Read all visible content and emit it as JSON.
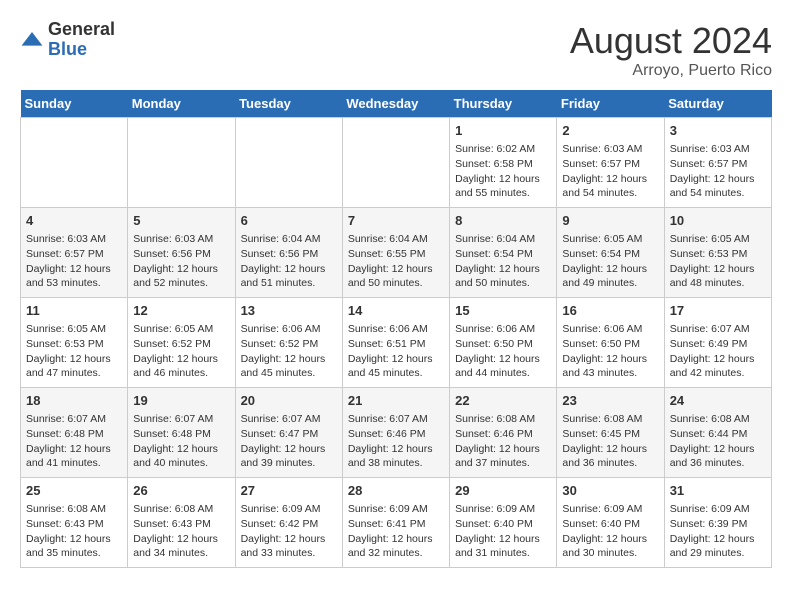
{
  "header": {
    "logo_general": "General",
    "logo_blue": "Blue",
    "main_title": "August 2024",
    "subtitle": "Arroyo, Puerto Rico"
  },
  "calendar": {
    "days_of_week": [
      "Sunday",
      "Monday",
      "Tuesday",
      "Wednesday",
      "Thursday",
      "Friday",
      "Saturday"
    ],
    "weeks": [
      [
        {
          "day": "",
          "info": ""
        },
        {
          "day": "",
          "info": ""
        },
        {
          "day": "",
          "info": ""
        },
        {
          "day": "",
          "info": ""
        },
        {
          "day": "1",
          "info": "Sunrise: 6:02 AM\nSunset: 6:58 PM\nDaylight: 12 hours\nand 55 minutes."
        },
        {
          "day": "2",
          "info": "Sunrise: 6:03 AM\nSunset: 6:57 PM\nDaylight: 12 hours\nand 54 minutes."
        },
        {
          "day": "3",
          "info": "Sunrise: 6:03 AM\nSunset: 6:57 PM\nDaylight: 12 hours\nand 54 minutes."
        }
      ],
      [
        {
          "day": "4",
          "info": "Sunrise: 6:03 AM\nSunset: 6:57 PM\nDaylight: 12 hours\nand 53 minutes."
        },
        {
          "day": "5",
          "info": "Sunrise: 6:03 AM\nSunset: 6:56 PM\nDaylight: 12 hours\nand 52 minutes."
        },
        {
          "day": "6",
          "info": "Sunrise: 6:04 AM\nSunset: 6:56 PM\nDaylight: 12 hours\nand 51 minutes."
        },
        {
          "day": "7",
          "info": "Sunrise: 6:04 AM\nSunset: 6:55 PM\nDaylight: 12 hours\nand 50 minutes."
        },
        {
          "day": "8",
          "info": "Sunrise: 6:04 AM\nSunset: 6:54 PM\nDaylight: 12 hours\nand 50 minutes."
        },
        {
          "day": "9",
          "info": "Sunrise: 6:05 AM\nSunset: 6:54 PM\nDaylight: 12 hours\nand 49 minutes."
        },
        {
          "day": "10",
          "info": "Sunrise: 6:05 AM\nSunset: 6:53 PM\nDaylight: 12 hours\nand 48 minutes."
        }
      ],
      [
        {
          "day": "11",
          "info": "Sunrise: 6:05 AM\nSunset: 6:53 PM\nDaylight: 12 hours\nand 47 minutes."
        },
        {
          "day": "12",
          "info": "Sunrise: 6:05 AM\nSunset: 6:52 PM\nDaylight: 12 hours\nand 46 minutes."
        },
        {
          "day": "13",
          "info": "Sunrise: 6:06 AM\nSunset: 6:52 PM\nDaylight: 12 hours\nand 45 minutes."
        },
        {
          "day": "14",
          "info": "Sunrise: 6:06 AM\nSunset: 6:51 PM\nDaylight: 12 hours\nand 45 minutes."
        },
        {
          "day": "15",
          "info": "Sunrise: 6:06 AM\nSunset: 6:50 PM\nDaylight: 12 hours\nand 44 minutes."
        },
        {
          "day": "16",
          "info": "Sunrise: 6:06 AM\nSunset: 6:50 PM\nDaylight: 12 hours\nand 43 minutes."
        },
        {
          "day": "17",
          "info": "Sunrise: 6:07 AM\nSunset: 6:49 PM\nDaylight: 12 hours\nand 42 minutes."
        }
      ],
      [
        {
          "day": "18",
          "info": "Sunrise: 6:07 AM\nSunset: 6:48 PM\nDaylight: 12 hours\nand 41 minutes."
        },
        {
          "day": "19",
          "info": "Sunrise: 6:07 AM\nSunset: 6:48 PM\nDaylight: 12 hours\nand 40 minutes."
        },
        {
          "day": "20",
          "info": "Sunrise: 6:07 AM\nSunset: 6:47 PM\nDaylight: 12 hours\nand 39 minutes."
        },
        {
          "day": "21",
          "info": "Sunrise: 6:07 AM\nSunset: 6:46 PM\nDaylight: 12 hours\nand 38 minutes."
        },
        {
          "day": "22",
          "info": "Sunrise: 6:08 AM\nSunset: 6:46 PM\nDaylight: 12 hours\nand 37 minutes."
        },
        {
          "day": "23",
          "info": "Sunrise: 6:08 AM\nSunset: 6:45 PM\nDaylight: 12 hours\nand 36 minutes."
        },
        {
          "day": "24",
          "info": "Sunrise: 6:08 AM\nSunset: 6:44 PM\nDaylight: 12 hours\nand 36 minutes."
        }
      ],
      [
        {
          "day": "25",
          "info": "Sunrise: 6:08 AM\nSunset: 6:43 PM\nDaylight: 12 hours\nand 35 minutes."
        },
        {
          "day": "26",
          "info": "Sunrise: 6:08 AM\nSunset: 6:43 PM\nDaylight: 12 hours\nand 34 minutes."
        },
        {
          "day": "27",
          "info": "Sunrise: 6:09 AM\nSunset: 6:42 PM\nDaylight: 12 hours\nand 33 minutes."
        },
        {
          "day": "28",
          "info": "Sunrise: 6:09 AM\nSunset: 6:41 PM\nDaylight: 12 hours\nand 32 minutes."
        },
        {
          "day": "29",
          "info": "Sunrise: 6:09 AM\nSunset: 6:40 PM\nDaylight: 12 hours\nand 31 minutes."
        },
        {
          "day": "30",
          "info": "Sunrise: 6:09 AM\nSunset: 6:40 PM\nDaylight: 12 hours\nand 30 minutes."
        },
        {
          "day": "31",
          "info": "Sunrise: 6:09 AM\nSunset: 6:39 PM\nDaylight: 12 hours\nand 29 minutes."
        }
      ]
    ]
  }
}
